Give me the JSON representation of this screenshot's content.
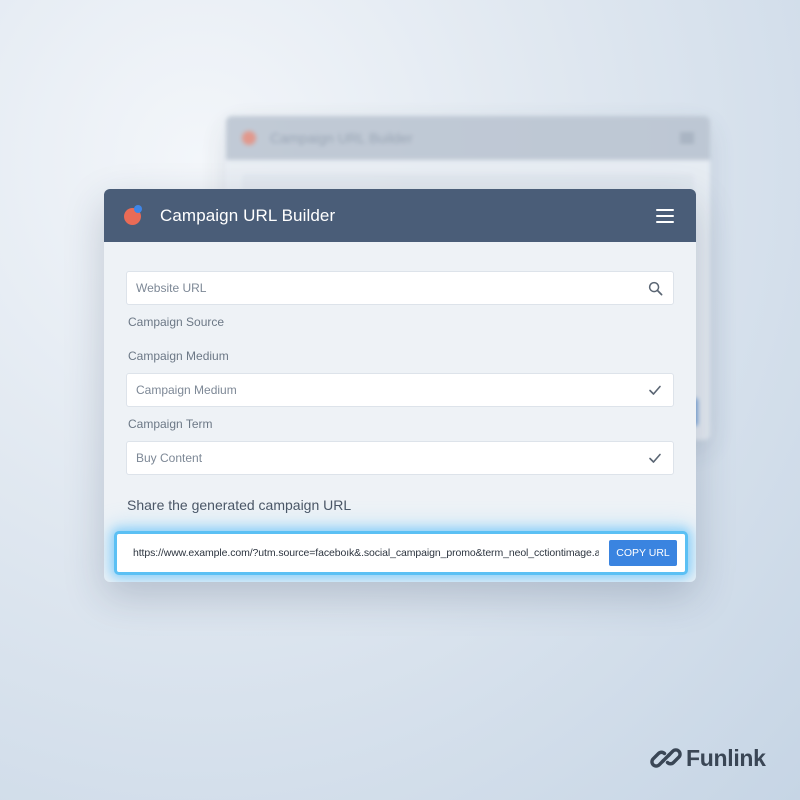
{
  "background_window": {
    "title": "Campaign URL Builder"
  },
  "window": {
    "title": "Campaign URL Builder",
    "menu_icon": "hamburger-menu-icon"
  },
  "form": {
    "website_url": {
      "placeholder": "Website URL",
      "icon": "search-icon"
    },
    "campaign_source": {
      "label": "Campaign Source"
    },
    "campaign_medium": {
      "label": "Campaign Medium",
      "value": "Campaign Medium",
      "icon": "checkmark-icon"
    },
    "campaign_term": {
      "label": "Campaign Term"
    },
    "campaign_content": {
      "value": "Buy Content",
      "icon": "checkmark-icon"
    }
  },
  "share": {
    "label": "Share the generated campaign URL",
    "url": "https://www.example.com/?utm.source=faceboık&.social_campaign_promo&term_neol_cctiontimage.ad",
    "copy_label": "COPY URL"
  },
  "brand": {
    "name": "Funlink",
    "icon": "chain-link-icon"
  },
  "colors": {
    "titlebar": "#4a5d78",
    "accent": "#3a84e0",
    "highlight_glow": "#5bc0f4",
    "logo_red": "#ea6b56",
    "logo_blue": "#3f86e8"
  }
}
